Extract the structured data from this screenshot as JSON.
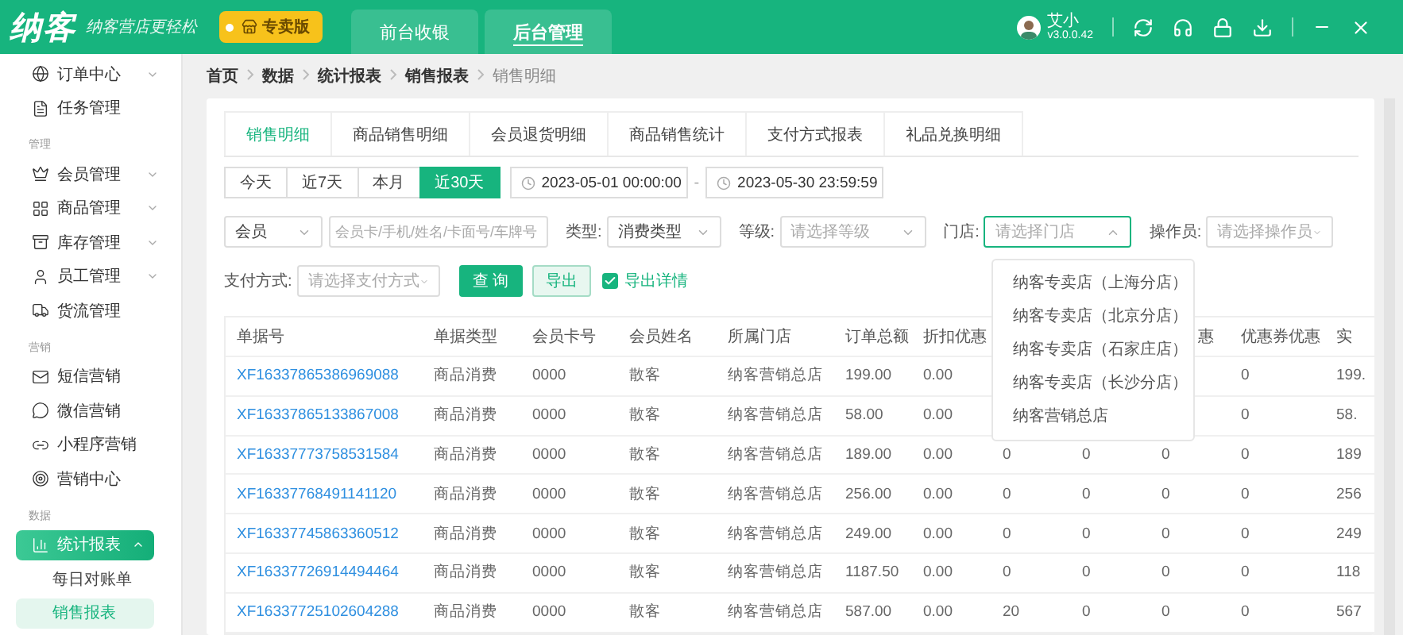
{
  "app": {
    "logo": "纳客",
    "slogan": "纳客营店更轻松",
    "edition": "专卖版",
    "nav": [
      {
        "label": "前台收银",
        "selected": false
      },
      {
        "label": "后台管理",
        "selected": true
      }
    ],
    "user": {
      "name": "艾小",
      "version": "v3.0.0.42"
    }
  },
  "sidebar": {
    "items": [
      {
        "kind": "item",
        "label": "订单中心",
        "expanded": false,
        "selected": false
      },
      {
        "kind": "item",
        "label": "任务管理",
        "selected": false
      },
      {
        "kind": "section",
        "label": "管理"
      },
      {
        "kind": "item",
        "label": "会员管理",
        "expanded": false,
        "selected": false
      },
      {
        "kind": "item",
        "label": "商品管理",
        "expanded": false,
        "selected": false
      },
      {
        "kind": "item",
        "label": "库存管理",
        "expanded": false,
        "selected": false
      },
      {
        "kind": "item",
        "label": "员工管理",
        "expanded": false,
        "selected": false
      },
      {
        "kind": "item",
        "label": "货流管理",
        "selected": false
      },
      {
        "kind": "section",
        "label": "营销"
      },
      {
        "kind": "item",
        "label": "短信营销",
        "selected": false
      },
      {
        "kind": "item",
        "label": "微信营销",
        "selected": false
      },
      {
        "kind": "item",
        "label": "小程序营销",
        "selected": false
      },
      {
        "kind": "item",
        "label": "营销中心",
        "selected": false
      },
      {
        "kind": "section",
        "label": "数据"
      },
      {
        "kind": "item",
        "label": "统计报表",
        "expanded": true,
        "selected": true,
        "children": [
          {
            "label": "每日对账单",
            "selected": false
          },
          {
            "label": "销售报表",
            "selected": true
          }
        ]
      }
    ]
  },
  "breadcrumb": [
    "首页",
    "数据",
    "统计报表",
    "销售报表",
    "销售明细"
  ],
  "tabs": [
    {
      "label": "销售明细",
      "selected": true
    },
    {
      "label": "商品销售明细",
      "selected": false
    },
    {
      "label": "会员退货明细",
      "selected": false
    },
    {
      "label": "商品销售统计",
      "selected": false
    },
    {
      "label": "支付方式报表",
      "selected": false
    },
    {
      "label": "礼品兑换明细",
      "selected": false
    }
  ],
  "ranges": [
    {
      "label": "今天",
      "selected": false
    },
    {
      "label": "近7天",
      "selected": false
    },
    {
      "label": "本月",
      "selected": false
    },
    {
      "label": "近30天",
      "selected": true
    }
  ],
  "date_start": "2023-05-01 00:00:00",
  "date_separator": "-",
  "date_end": "2023-05-30 23:59:59",
  "filters": [
    {
      "kind": "select",
      "value": "会员",
      "open": false
    },
    {
      "kind": "input",
      "placeholder": "会员卡/手机/姓名/卡面号/车牌号"
    },
    {
      "kind": "select",
      "label": "类型:",
      "value": "消费类型",
      "open": false
    },
    {
      "kind": "select",
      "label": "等级:",
      "placeholder": "请选择等级",
      "open": false
    },
    {
      "kind": "select",
      "label": "门店:",
      "placeholder": "请选择门店",
      "open": true,
      "options": [
        "纳客专卖店（上海分店）",
        "纳客专卖店（北京分店）",
        "纳客专卖店（石家庄店）",
        "纳客专卖店（长沙分店）",
        "纳客营销总店"
      ]
    },
    {
      "kind": "select",
      "label": "操作员:",
      "placeholder": "请选择操作员",
      "open": false
    }
  ],
  "payment": {
    "label": "支付方式:",
    "placeholder": "请选择支付方式"
  },
  "actions": {
    "query": "查 询",
    "export": "导出",
    "export_detail": {
      "label": "导出详情",
      "checked": true
    }
  },
  "table": {
    "columns": [
      "单据号",
      "单据类型",
      "会员卡号",
      "会员姓名",
      "所属门店",
      "订单总额",
      "折扣优惠",
      null,
      null,
      "惠",
      "优惠券优惠",
      "实"
    ],
    "rows": [
      [
        "XF16337865386969088",
        "商品消费",
        "0000",
        "散客",
        "纳客营销总店",
        "199.00",
        "0.00",
        null,
        null,
        null,
        "0",
        "199."
      ],
      [
        "XF16337865133867008",
        "商品消费",
        "0000",
        "散客",
        "纳客营销总店",
        "58.00",
        "0.00",
        null,
        null,
        null,
        "0",
        "58."
      ],
      [
        "XF16337773758531584",
        "商品消费",
        "0000",
        "散客",
        "纳客营销总店",
        "189.00",
        "0.00",
        "0",
        "0",
        "0",
        "0",
        "189"
      ],
      [
        "XF16337768491141120",
        "商品消费",
        "0000",
        "散客",
        "纳客营销总店",
        "256.00",
        "0.00",
        "0",
        "0",
        "0",
        "0",
        "256"
      ],
      [
        "XF16337745863360512",
        "商品消费",
        "0000",
        "散客",
        "纳客营销总店",
        "249.00",
        "0.00",
        "0",
        "0",
        "0",
        "0",
        "249"
      ],
      [
        "XF16337726914494464",
        "商品消费",
        "0000",
        "散客",
        "纳客营销总店",
        "1187.50",
        "0.00",
        "0",
        "0",
        "0",
        "0",
        "118"
      ],
      [
        "XF16337725102604288",
        "商品消费",
        "0000",
        "散客",
        "纳客营销总店",
        "587.00",
        "0.00",
        "20",
        "0",
        "0",
        "0",
        "567"
      ]
    ]
  }
}
